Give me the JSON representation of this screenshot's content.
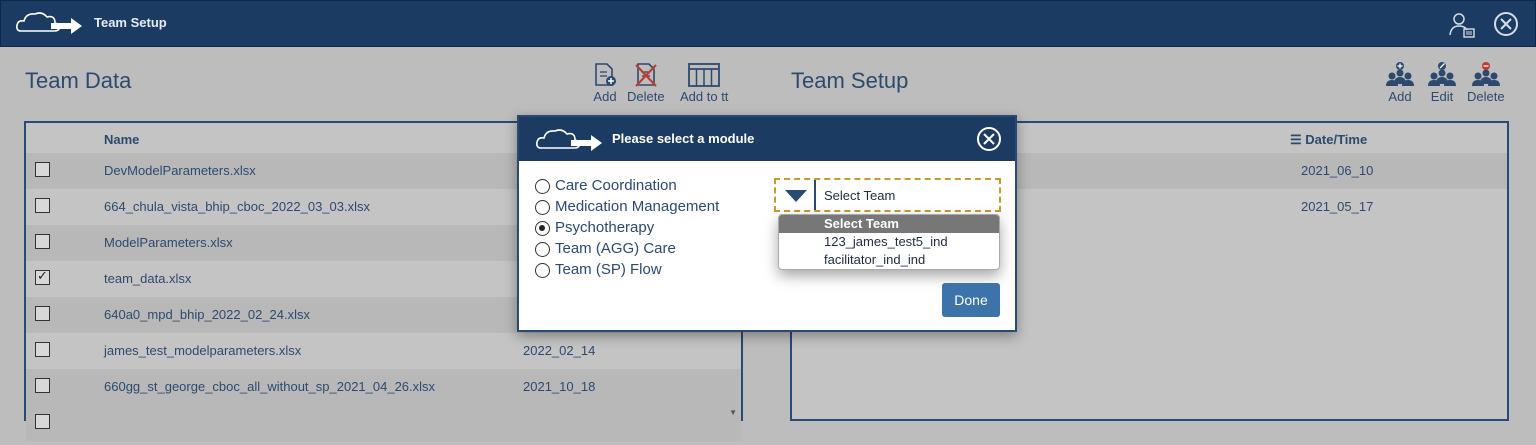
{
  "app": {
    "title": "Team Setup"
  },
  "left": {
    "title": "Team Data",
    "toolbar": {
      "add": "Add",
      "delete": "Delete",
      "add_to_tt": "Add to tt"
    },
    "columns": {
      "name": "Name"
    },
    "rows": [
      {
        "name": "DevModelParameters.xlsx",
        "date": "",
        "checked": false
      },
      {
        "name": "664_chula_vista_bhip_cboc_2022_03_03.xlsx",
        "date": "",
        "checked": false
      },
      {
        "name": "ModelParameters.xlsx",
        "date": "",
        "checked": false
      },
      {
        "name": "team_data.xlsx",
        "date": "",
        "checked": true
      },
      {
        "name": "640a0_mpd_bhip_2022_02_24.xlsx",
        "date": "",
        "checked": false
      },
      {
        "name": "james_test_modelparameters.xlsx",
        "date": "2022_02_14",
        "checked": false
      },
      {
        "name": "660gg_st_george_cboc_all_without_sp_2021_04_26.xlsx",
        "date": "2021_10_18",
        "checked": false
      }
    ]
  },
  "right": {
    "title": "Team Setup",
    "toolbar": {
      "add": "Add",
      "edit": "Edit",
      "delete": "Delete"
    },
    "columns": {
      "datetime": "Date/Time"
    },
    "rows": [
      {
        "date": "2021_06_10"
      },
      {
        "date": "2021_05_17"
      }
    ]
  },
  "modal": {
    "title": "Please select a module",
    "options": [
      "Care Coordination",
      "Medication Management",
      "Psychotherapy",
      "Team (AGG) Care",
      "Team (SP) Flow"
    ],
    "selected_option": "Psychotherapy",
    "dropdown": {
      "value": "Select Team",
      "items": [
        "Select Team",
        "123_james_test5_ind",
        "facilitator_ind_ind"
      ],
      "highlighted": "Select Team"
    },
    "done_label": "Done"
  },
  "colors": {
    "navy": "#1b3b63",
    "accent": "#3b73aa",
    "arrow": "#e8403f",
    "focus_border": "#c79a2e"
  }
}
